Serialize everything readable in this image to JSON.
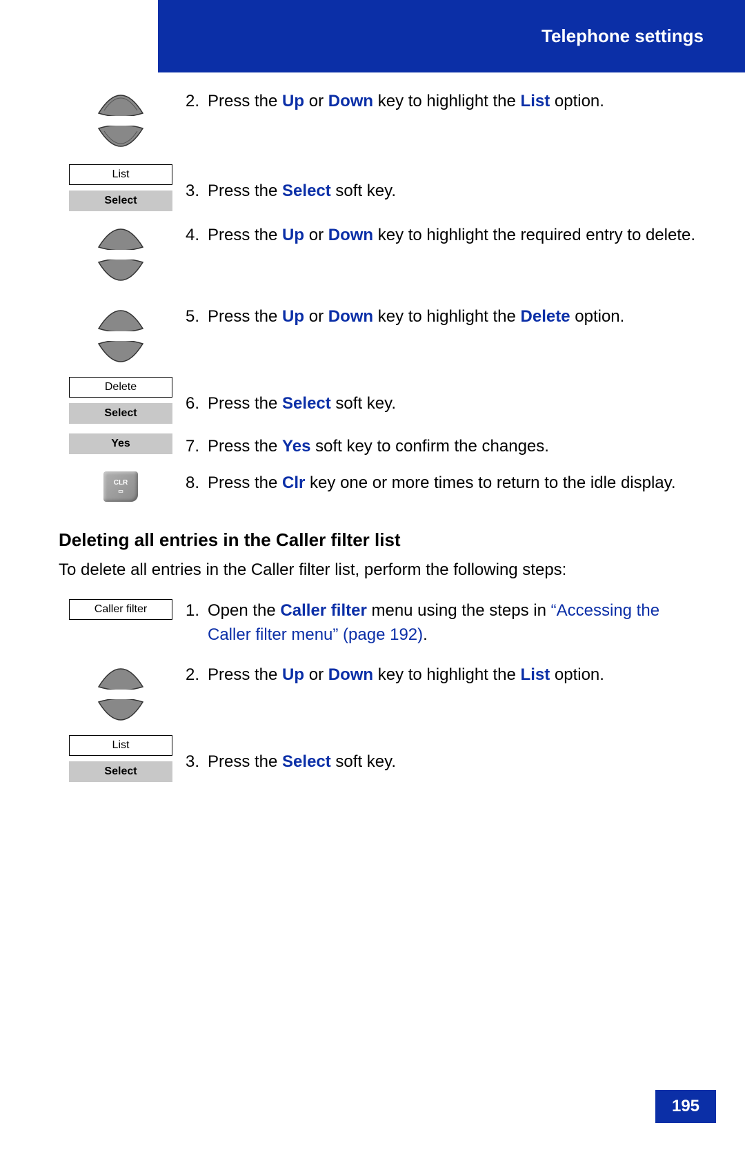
{
  "header": {
    "title": "Telephone settings"
  },
  "steps_a": [
    {
      "num": "2.",
      "parts": [
        {
          "t": "Press the "
        },
        {
          "t": "Up",
          "kw": true
        },
        {
          "t": " or "
        },
        {
          "t": "Down",
          "kw": true
        },
        {
          "t": " key to highlight the "
        },
        {
          "t": "List",
          "kw": true
        },
        {
          "t": " option."
        }
      ]
    },
    {
      "num": "3.",
      "parts": [
        {
          "t": "Press the "
        },
        {
          "t": "Select",
          "kw": true
        },
        {
          "t": " soft key."
        }
      ]
    },
    {
      "num": "4.",
      "parts": [
        {
          "t": "Press the "
        },
        {
          "t": "Up",
          "kw": true
        },
        {
          "t": " or "
        },
        {
          "t": "Down",
          "kw": true
        },
        {
          "t": " key to highlight the required entry to delete."
        }
      ]
    },
    {
      "num": "5.",
      "parts": [
        {
          "t": "Press the "
        },
        {
          "t": "Up",
          "kw": true
        },
        {
          "t": " or "
        },
        {
          "t": "Down",
          "kw": true
        },
        {
          "t": " key to highlight the "
        },
        {
          "t": "Delete",
          "kw": true
        },
        {
          "t": " option."
        }
      ]
    },
    {
      "num": "6.",
      "parts": [
        {
          "t": "Press the "
        },
        {
          "t": "Select",
          "kw": true
        },
        {
          "t": " soft key."
        }
      ]
    },
    {
      "num": "7.",
      "parts": [
        {
          "t": "Press the "
        },
        {
          "t": "Yes",
          "kw": true
        },
        {
          "t": " soft key to confirm the changes."
        }
      ]
    },
    {
      "num": "8.",
      "parts": [
        {
          "t": "Press the "
        },
        {
          "t": "Clr",
          "kw": true
        },
        {
          "t": " key one or more times to return to the idle display."
        }
      ]
    }
  ],
  "section_b": {
    "heading": "Deleting all entries in the Caller filter list",
    "intro": "To delete all entries in the Caller filter list, perform the following steps:",
    "steps": [
      {
        "num": "1.",
        "parts": [
          {
            "t": "Open the "
          },
          {
            "t": "Caller filter",
            "kw": true
          },
          {
            "t": " menu using the steps in "
          },
          {
            "t": "“Accessing the Caller filter menu” (page 192)",
            "link": true
          },
          {
            "t": "."
          }
        ]
      },
      {
        "num": "2.",
        "parts": [
          {
            "t": "Press the "
          },
          {
            "t": "Up",
            "kw": true
          },
          {
            "t": " or "
          },
          {
            "t": "Down",
            "kw": true
          },
          {
            "t": " key to highlight the "
          },
          {
            "t": "List",
            "kw": true
          },
          {
            "t": " option."
          }
        ]
      },
      {
        "num": "3.",
        "parts": [
          {
            "t": "Press the "
          },
          {
            "t": "Select",
            "kw": true
          },
          {
            "t": " soft key."
          }
        ]
      }
    ]
  },
  "buttons": {
    "list": "List",
    "select": "Select",
    "delete": "Delete",
    "yes": "Yes",
    "caller_filter": "Caller filter",
    "clr": "CLR"
  },
  "page_number": "195"
}
